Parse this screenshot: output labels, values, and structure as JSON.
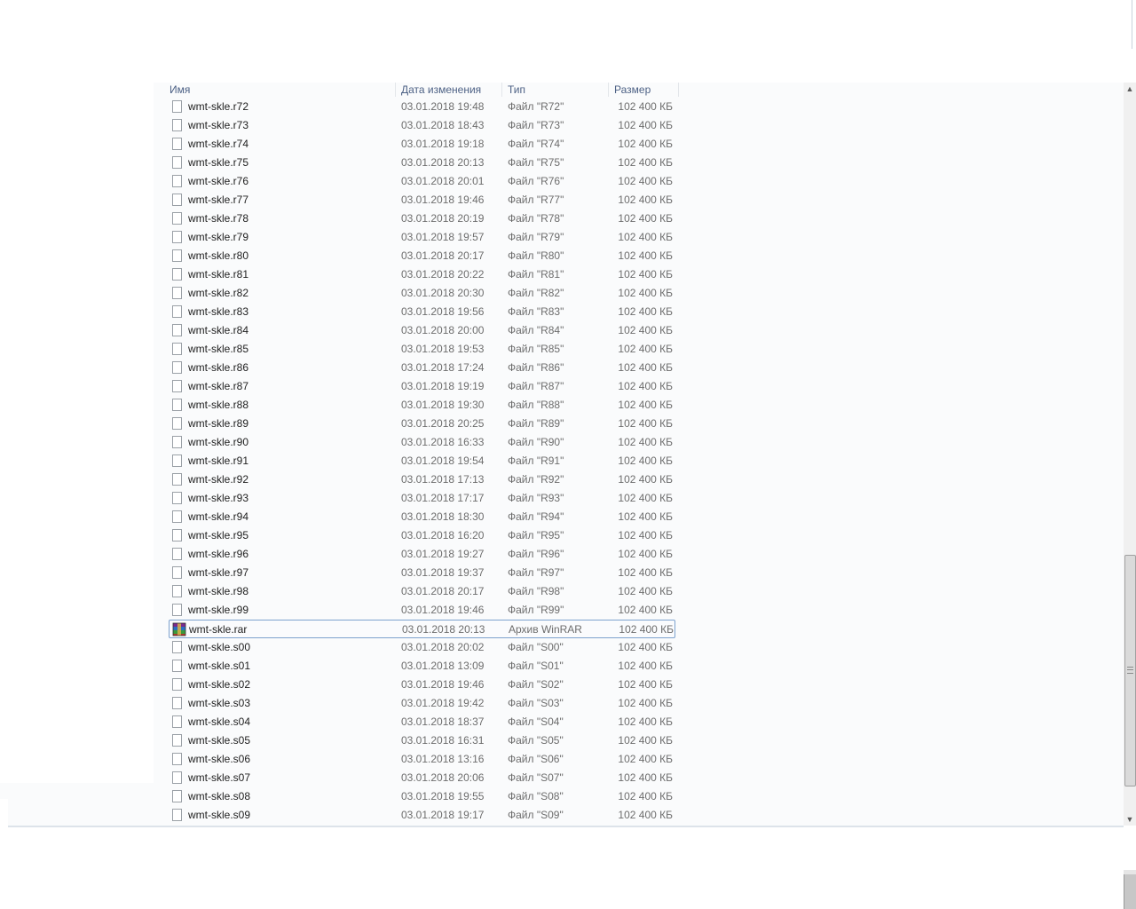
{
  "columns": {
    "name": "Имя",
    "date": "Дата изменения",
    "type": "Тип",
    "size": "Размер"
  },
  "files": [
    {
      "name": "wmt-skle.r72",
      "date": "03.01.2018 19:48",
      "type": "Файл \"R72\"",
      "size": "102 400 КБ"
    },
    {
      "name": "wmt-skle.r73",
      "date": "03.01.2018 18:43",
      "type": "Файл \"R73\"",
      "size": "102 400 КБ"
    },
    {
      "name": "wmt-skle.r74",
      "date": "03.01.2018 19:18",
      "type": "Файл \"R74\"",
      "size": "102 400 КБ"
    },
    {
      "name": "wmt-skle.r75",
      "date": "03.01.2018 20:13",
      "type": "Файл \"R75\"",
      "size": "102 400 КБ"
    },
    {
      "name": "wmt-skle.r76",
      "date": "03.01.2018 20:01",
      "type": "Файл \"R76\"",
      "size": "102 400 КБ"
    },
    {
      "name": "wmt-skle.r77",
      "date": "03.01.2018 19:46",
      "type": "Файл \"R77\"",
      "size": "102 400 КБ"
    },
    {
      "name": "wmt-skle.r78",
      "date": "03.01.2018 20:19",
      "type": "Файл \"R78\"",
      "size": "102 400 КБ"
    },
    {
      "name": "wmt-skle.r79",
      "date": "03.01.2018 19:57",
      "type": "Файл \"R79\"",
      "size": "102 400 КБ"
    },
    {
      "name": "wmt-skle.r80",
      "date": "03.01.2018 20:17",
      "type": "Файл \"R80\"",
      "size": "102 400 КБ"
    },
    {
      "name": "wmt-skle.r81",
      "date": "03.01.2018 20:22",
      "type": "Файл \"R81\"",
      "size": "102 400 КБ"
    },
    {
      "name": "wmt-skle.r82",
      "date": "03.01.2018 20:30",
      "type": "Файл \"R82\"",
      "size": "102 400 КБ"
    },
    {
      "name": "wmt-skle.r83",
      "date": "03.01.2018 19:56",
      "type": "Файл \"R83\"",
      "size": "102 400 КБ"
    },
    {
      "name": "wmt-skle.r84",
      "date": "03.01.2018 20:00",
      "type": "Файл \"R84\"",
      "size": "102 400 КБ"
    },
    {
      "name": "wmt-skle.r85",
      "date": "03.01.2018 19:53",
      "type": "Файл \"R85\"",
      "size": "102 400 КБ"
    },
    {
      "name": "wmt-skle.r86",
      "date": "03.01.2018 17:24",
      "type": "Файл \"R86\"",
      "size": "102 400 КБ"
    },
    {
      "name": "wmt-skle.r87",
      "date": "03.01.2018 19:19",
      "type": "Файл \"R87\"",
      "size": "102 400 КБ"
    },
    {
      "name": "wmt-skle.r88",
      "date": "03.01.2018 19:30",
      "type": "Файл \"R88\"",
      "size": "102 400 КБ"
    },
    {
      "name": "wmt-skle.r89",
      "date": "03.01.2018 20:25",
      "type": "Файл \"R89\"",
      "size": "102 400 КБ"
    },
    {
      "name": "wmt-skle.r90",
      "date": "03.01.2018 16:33",
      "type": "Файл \"R90\"",
      "size": "102 400 КБ"
    },
    {
      "name": "wmt-skle.r91",
      "date": "03.01.2018 19:54",
      "type": "Файл \"R91\"",
      "size": "102 400 КБ"
    },
    {
      "name": "wmt-skle.r92",
      "date": "03.01.2018 17:13",
      "type": "Файл \"R92\"",
      "size": "102 400 КБ"
    },
    {
      "name": "wmt-skle.r93",
      "date": "03.01.2018 17:17",
      "type": "Файл \"R93\"",
      "size": "102 400 КБ"
    },
    {
      "name": "wmt-skle.r94",
      "date": "03.01.2018 18:30",
      "type": "Файл \"R94\"",
      "size": "102 400 КБ"
    },
    {
      "name": "wmt-skle.r95",
      "date": "03.01.2018 16:20",
      "type": "Файл \"R95\"",
      "size": "102 400 КБ"
    },
    {
      "name": "wmt-skle.r96",
      "date": "03.01.2018 19:27",
      "type": "Файл \"R96\"",
      "size": "102 400 КБ"
    },
    {
      "name": "wmt-skle.r97",
      "date": "03.01.2018 19:37",
      "type": "Файл \"R97\"",
      "size": "102 400 КБ"
    },
    {
      "name": "wmt-skle.r98",
      "date": "03.01.2018 20:17",
      "type": "Файл \"R98\"",
      "size": "102 400 КБ"
    },
    {
      "name": "wmt-skle.r99",
      "date": "03.01.2018 19:46",
      "type": "Файл \"R99\"",
      "size": "102 400 КБ"
    },
    {
      "name": "wmt-skle.rar",
      "date": "03.01.2018 20:13",
      "type": "Архив WinRAR",
      "size": "102 400 КБ",
      "icon": "winrar-archive-icon",
      "selected": true
    },
    {
      "name": "wmt-skle.s00",
      "date": "03.01.2018 20:02",
      "type": "Файл \"S00\"",
      "size": "102 400 КБ"
    },
    {
      "name": "wmt-skle.s01",
      "date": "03.01.2018 13:09",
      "type": "Файл \"S01\"",
      "size": "102 400 КБ"
    },
    {
      "name": "wmt-skle.s02",
      "date": "03.01.2018 19:46",
      "type": "Файл \"S02\"",
      "size": "102 400 КБ"
    },
    {
      "name": "wmt-skle.s03",
      "date": "03.01.2018 19:42",
      "type": "Файл \"S03\"",
      "size": "102 400 КБ"
    },
    {
      "name": "wmt-skle.s04",
      "date": "03.01.2018 18:37",
      "type": "Файл \"S04\"",
      "size": "102 400 КБ"
    },
    {
      "name": "wmt-skle.s05",
      "date": "03.01.2018 16:31",
      "type": "Файл \"S05\"",
      "size": "102 400 КБ"
    },
    {
      "name": "wmt-skle.s06",
      "date": "03.01.2018 13:16",
      "type": "Файл \"S06\"",
      "size": "102 400 КБ"
    },
    {
      "name": "wmt-skle.s07",
      "date": "03.01.2018 20:06",
      "type": "Файл \"S07\"",
      "size": "102 400 КБ"
    },
    {
      "name": "wmt-skle.s08",
      "date": "03.01.2018 19:55",
      "type": "Файл \"S08\"",
      "size": "102 400 КБ"
    },
    {
      "name": "wmt-skle.s09",
      "date": "03.01.2018 19:17",
      "type": "Файл \"S09\"",
      "size": "102 400 КБ"
    }
  ],
  "icons": {
    "file": "blank-file-icon",
    "scroll_up": "scroll-up-arrow-icon",
    "scroll_down": "scroll-down-arrow-icon"
  },
  "colors": {
    "header_text": "#4d6185",
    "selection_border": "#7da2ce",
    "panel_bg": "#fafbfc"
  }
}
